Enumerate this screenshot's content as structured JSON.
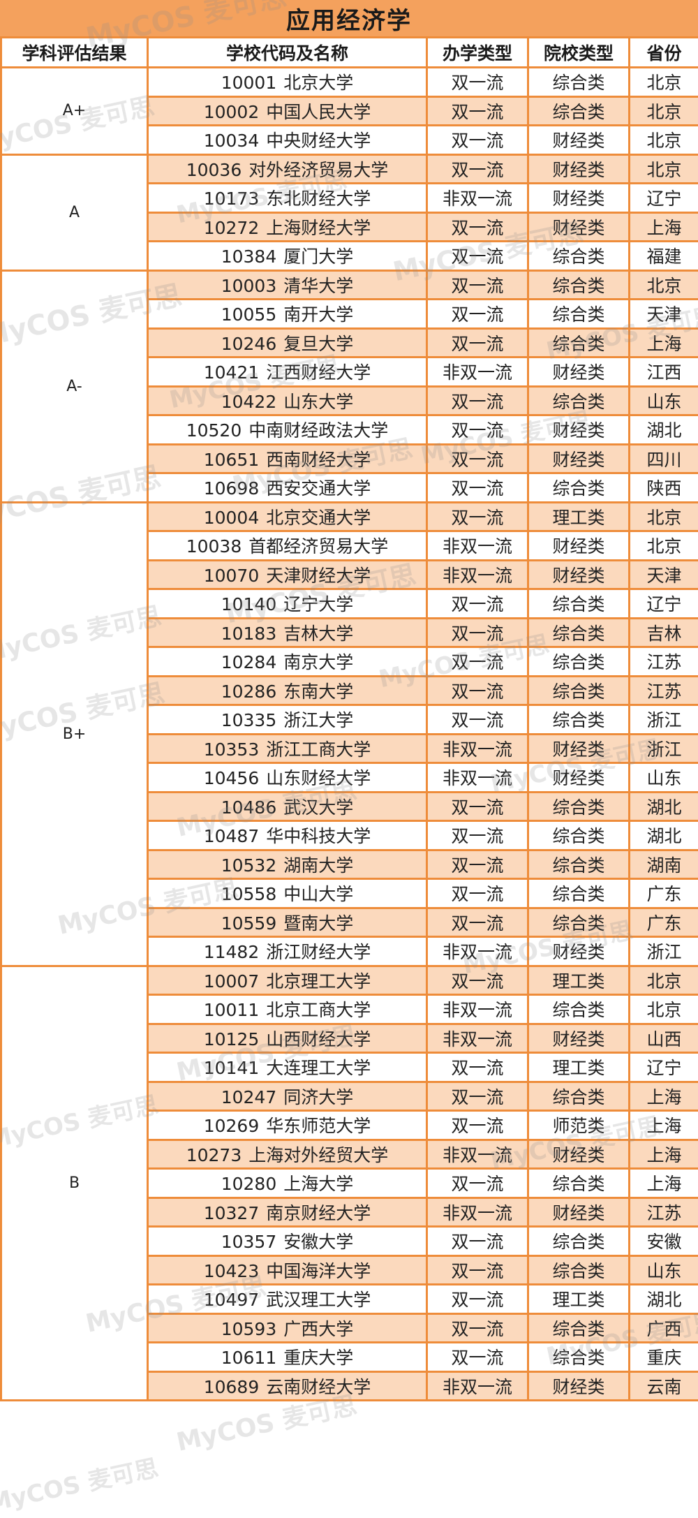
{
  "title": "应用经济学",
  "headers": [
    "学科评估结果",
    "学校代码及名称",
    "办学类型",
    "院校类型",
    "省份"
  ],
  "watermark": "MyCOS 麦可思",
  "colors": {
    "accent": "#ee8c3a",
    "title_bg": "#f4a15d",
    "stripe": "#fbd9bd"
  },
  "groups": [
    {
      "grade": "A+",
      "rows": [
        {
          "code": "10001",
          "name": "北京大学",
          "run_type": "双一流",
          "school_type": "综合类",
          "province": "北京"
        },
        {
          "code": "10002",
          "name": "中国人民大学",
          "run_type": "双一流",
          "school_type": "综合类",
          "province": "北京"
        },
        {
          "code": "10034",
          "name": "中央财经大学",
          "run_type": "双一流",
          "school_type": "财经类",
          "province": "北京"
        }
      ]
    },
    {
      "grade": "A",
      "rows": [
        {
          "code": "10036",
          "name": "对外经济贸易大学",
          "run_type": "双一流",
          "school_type": "财经类",
          "province": "北京"
        },
        {
          "code": "10173",
          "name": "东北财经大学",
          "run_type": "非双一流",
          "school_type": "财经类",
          "province": "辽宁"
        },
        {
          "code": "10272",
          "name": "上海财经大学",
          "run_type": "双一流",
          "school_type": "财经类",
          "province": "上海"
        },
        {
          "code": "10384",
          "name": "厦门大学",
          "run_type": "双一流",
          "school_type": "综合类",
          "province": "福建"
        }
      ]
    },
    {
      "grade": "A-",
      "rows": [
        {
          "code": "10003",
          "name": "清华大学",
          "run_type": "双一流",
          "school_type": "综合类",
          "province": "北京"
        },
        {
          "code": "10055",
          "name": "南开大学",
          "run_type": "双一流",
          "school_type": "综合类",
          "province": "天津"
        },
        {
          "code": "10246",
          "name": "复旦大学",
          "run_type": "双一流",
          "school_type": "综合类",
          "province": "上海"
        },
        {
          "code": "10421",
          "name": "江西财经大学",
          "run_type": "非双一流",
          "school_type": "财经类",
          "province": "江西"
        },
        {
          "code": "10422",
          "name": "山东大学",
          "run_type": "双一流",
          "school_type": "综合类",
          "province": "山东"
        },
        {
          "code": "10520",
          "name": "中南财经政法大学",
          "run_type": "双一流",
          "school_type": "财经类",
          "province": "湖北"
        },
        {
          "code": "10651",
          "name": "西南财经大学",
          "run_type": "双一流",
          "school_type": "财经类",
          "province": "四川"
        },
        {
          "code": "10698",
          "name": "西安交通大学",
          "run_type": "双一流",
          "school_type": "综合类",
          "province": "陕西"
        }
      ]
    },
    {
      "grade": "B+",
      "rows": [
        {
          "code": "10004",
          "name": "北京交通大学",
          "run_type": "双一流",
          "school_type": "理工类",
          "province": "北京"
        },
        {
          "code": "10038",
          "name": "首都经济贸易大学",
          "run_type": "非双一流",
          "school_type": "财经类",
          "province": "北京"
        },
        {
          "code": "10070",
          "name": "天津财经大学",
          "run_type": "非双一流",
          "school_type": "财经类",
          "province": "天津"
        },
        {
          "code": "10140",
          "name": "辽宁大学",
          "run_type": "双一流",
          "school_type": "综合类",
          "province": "辽宁"
        },
        {
          "code": "10183",
          "name": "吉林大学",
          "run_type": "双一流",
          "school_type": "综合类",
          "province": "吉林"
        },
        {
          "code": "10284",
          "name": "南京大学",
          "run_type": "双一流",
          "school_type": "综合类",
          "province": "江苏"
        },
        {
          "code": "10286",
          "name": "东南大学",
          "run_type": "双一流",
          "school_type": "综合类",
          "province": "江苏"
        },
        {
          "code": "10335",
          "name": "浙江大学",
          "run_type": "双一流",
          "school_type": "综合类",
          "province": "浙江"
        },
        {
          "code": "10353",
          "name": "浙江工商大学",
          "run_type": "非双一流",
          "school_type": "财经类",
          "province": "浙江"
        },
        {
          "code": "10456",
          "name": "山东财经大学",
          "run_type": "非双一流",
          "school_type": "财经类",
          "province": "山东"
        },
        {
          "code": "10486",
          "name": "武汉大学",
          "run_type": "双一流",
          "school_type": "综合类",
          "province": "湖北"
        },
        {
          "code": "10487",
          "name": "华中科技大学",
          "run_type": "双一流",
          "school_type": "综合类",
          "province": "湖北"
        },
        {
          "code": "10532",
          "name": "湖南大学",
          "run_type": "双一流",
          "school_type": "综合类",
          "province": "湖南"
        },
        {
          "code": "10558",
          "name": "中山大学",
          "run_type": "双一流",
          "school_type": "综合类",
          "province": "广东"
        },
        {
          "code": "10559",
          "name": "暨南大学",
          "run_type": "双一流",
          "school_type": "综合类",
          "province": "广东"
        },
        {
          "code": "11482",
          "name": "浙江财经大学",
          "run_type": "非双一流",
          "school_type": "财经类",
          "province": "浙江"
        }
      ]
    },
    {
      "grade": "B",
      "rows": [
        {
          "code": "10007",
          "name": "北京理工大学",
          "run_type": "双一流",
          "school_type": "理工类",
          "province": "北京"
        },
        {
          "code": "10011",
          "name": "北京工商大学",
          "run_type": "非双一流",
          "school_type": "综合类",
          "province": "北京"
        },
        {
          "code": "10125",
          "name": "山西财经大学",
          "run_type": "非双一流",
          "school_type": "财经类",
          "province": "山西"
        },
        {
          "code": "10141",
          "name": "大连理工大学",
          "run_type": "双一流",
          "school_type": "理工类",
          "province": "辽宁"
        },
        {
          "code": "10247",
          "name": "同济大学",
          "run_type": "双一流",
          "school_type": "综合类",
          "province": "上海"
        },
        {
          "code": "10269",
          "name": "华东师范大学",
          "run_type": "双一流",
          "school_type": "师范类",
          "province": "上海"
        },
        {
          "code": "10273",
          "name": "上海对外经贸大学",
          "run_type": "非双一流",
          "school_type": "财经类",
          "province": "上海"
        },
        {
          "code": "10280",
          "name": "上海大学",
          "run_type": "双一流",
          "school_type": "综合类",
          "province": "上海"
        },
        {
          "code": "10327",
          "name": "南京财经大学",
          "run_type": "非双一流",
          "school_type": "财经类",
          "province": "江苏"
        },
        {
          "code": "10357",
          "name": "安徽大学",
          "run_type": "双一流",
          "school_type": "综合类",
          "province": "安徽"
        },
        {
          "code": "10423",
          "name": "中国海洋大学",
          "run_type": "双一流",
          "school_type": "综合类",
          "province": "山东"
        },
        {
          "code": "10497",
          "name": "武汉理工大学",
          "run_type": "双一流",
          "school_type": "理工类",
          "province": "湖北"
        },
        {
          "code": "10593",
          "name": "广西大学",
          "run_type": "双一流",
          "school_type": "综合类",
          "province": "广西"
        },
        {
          "code": "10611",
          "name": "重庆大学",
          "run_type": "双一流",
          "school_type": "综合类",
          "province": "重庆"
        },
        {
          "code": "10689",
          "name": "云南财经大学",
          "run_type": "非双一流",
          "school_type": "财经类",
          "province": "云南"
        }
      ]
    }
  ]
}
